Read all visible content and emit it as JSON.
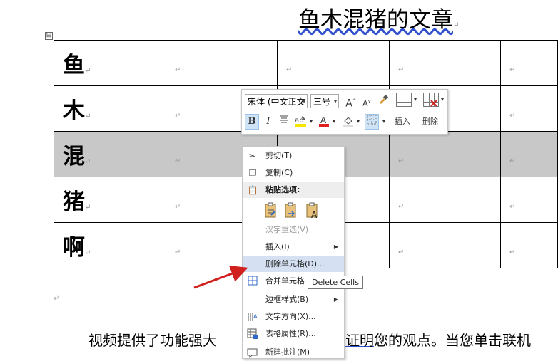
{
  "document": {
    "title": "鱼木混猪的文章",
    "rows": [
      {
        "label": "鱼"
      },
      {
        "label": "木"
      },
      {
        "label": "混"
      },
      {
        "label": "猪"
      },
      {
        "label": "啊"
      }
    ],
    "body_text_left": "视频提供了功能强大",
    "body_text_right_underlined": "证明",
    "body_text_right": "您的观点。当您单击联机",
    "paragraph_mark": "↵",
    "table_handle": "⊞"
  },
  "mini_toolbar": {
    "font_name": "宋体 (中文正文",
    "font_size": "三号",
    "grow_font": "A",
    "shrink_font": "A",
    "bold": "B",
    "italic": "I",
    "insert_label": "插入",
    "delete_label": "删除"
  },
  "context_menu": {
    "items": [
      {
        "label": "剪切(T)",
        "icon": "scissors-icon"
      },
      {
        "label": "复制(C)",
        "icon": "copy-icon"
      },
      {
        "label": "粘贴选项:",
        "icon": "paste-icon"
      },
      {
        "label": "汉字重选(V)",
        "icon": ""
      },
      {
        "label": "插入(I)",
        "icon": ""
      },
      {
        "label": "删除单元格(D)...",
        "icon": ""
      },
      {
        "label": "合并单元格",
        "icon": "merge-cells-icon"
      },
      {
        "label": "边框样式(B)",
        "icon": ""
      },
      {
        "label": "文字方向(X)...",
        "icon": "text-direction-icon"
      },
      {
        "label": "表格属性(R)...",
        "icon": "table-properties-icon"
      },
      {
        "label": "新建批注(M)",
        "icon": "new-comment-icon"
      }
    ]
  },
  "tooltip": "Delete Cells",
  "colors": {
    "selection": "#c8c8c8",
    "menu_hover": "#d5e1f2",
    "arrow": "#d0211f",
    "font_color_bar": "#e02020",
    "highlight_bar": "#f5e600"
  }
}
